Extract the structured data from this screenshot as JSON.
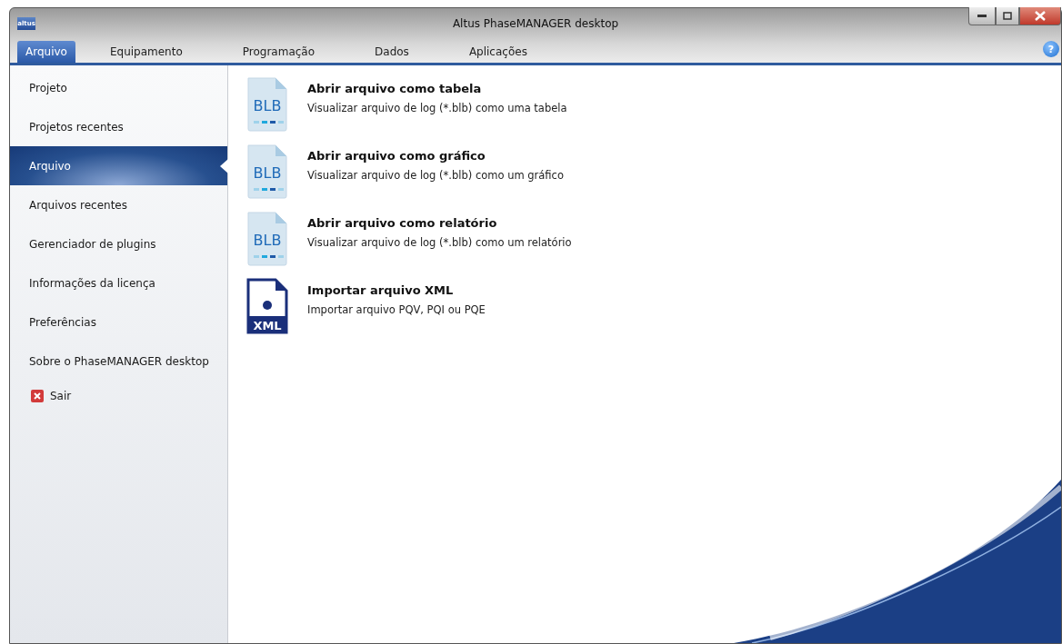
{
  "window": {
    "logo": "altus",
    "title": "Altus PhaseMANAGER desktop",
    "help": "?"
  },
  "tabs": [
    {
      "label": "Arquivo",
      "selected": true
    },
    {
      "label": "Equipamento",
      "selected": false
    },
    {
      "label": "Programação",
      "selected": false
    },
    {
      "label": "Dados",
      "selected": false
    },
    {
      "label": "Aplicações",
      "selected": false
    }
  ],
  "sidebar": {
    "items": [
      {
        "label": "Projeto",
        "selected": false,
        "kind": "plain"
      },
      {
        "label": "Projetos recentes",
        "selected": false,
        "kind": "plain"
      },
      {
        "label": "Arquivo",
        "selected": true,
        "kind": "plain"
      },
      {
        "label": "Arquivos recentes",
        "selected": false,
        "kind": "plain"
      },
      {
        "label": "Gerenciador de plugins",
        "selected": false,
        "kind": "plain"
      },
      {
        "label": "Informações da licença",
        "selected": false,
        "kind": "plain"
      },
      {
        "label": "Preferências",
        "selected": false,
        "kind": "plain"
      },
      {
        "label": "Sobre o PhaseMANAGER desktop",
        "selected": false,
        "kind": "plain"
      },
      {
        "label": "Sair",
        "selected": false,
        "kind": "exit"
      }
    ]
  },
  "actions": [
    {
      "kind": "blb",
      "icon_label": "BLB",
      "title": "Abrir arquivo como tabela",
      "description": "Visualizar arquivo de log (*.blb) como uma tabela"
    },
    {
      "kind": "blb",
      "icon_label": "BLB",
      "title": "Abrir arquivo como gráfico",
      "description": "Visualizar arquivo de log (*.blb) como um gráfico"
    },
    {
      "kind": "blb",
      "icon_label": "BLB",
      "title": "Abrir arquivo como relatório",
      "description": "Visualizar arquivo de log (*.blb) como um relatório"
    },
    {
      "kind": "xml",
      "icon_label": "XML",
      "title": "Importar arquivo XML",
      "description": "Importar arquivo PQV, PQI ou PQE"
    }
  ]
}
